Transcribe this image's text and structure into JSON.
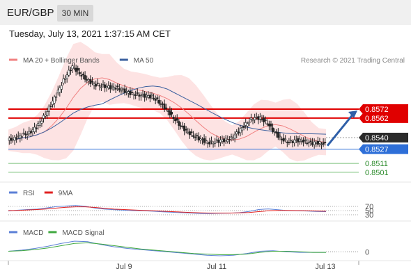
{
  "header": {
    "pair": "EUR/GBP",
    "interval": "30 MIN"
  },
  "timestamp": "Tuesday, July 13, 2021 1:37:15 AM CET",
  "main_panel": {
    "legend": [
      {
        "name": "MA 20 + Bollinger Bands",
        "color": "#f08080"
      },
      {
        "name": "MA 50",
        "color": "#3a5f9e"
      }
    ],
    "credit": "Research © 2021 Trading Central"
  },
  "rsi_panel": {
    "legend": [
      {
        "name": "RSI",
        "color": "#5b7fd6"
      },
      {
        "name": "9MA",
        "color": "#e02020"
      }
    ]
  },
  "macd_panel": {
    "legend": [
      {
        "name": "MACD",
        "color": "#5b7fd6"
      },
      {
        "name": "MACD Signal",
        "color": "#3fa83f"
      }
    ]
  },
  "chart_data": [
    {
      "type": "candlestick",
      "title": "EUR/GBP",
      "x_labels": [
        "Jul 9",
        "Jul 11",
        "Jul 13"
      ],
      "ylim": [
        0.849,
        0.864
      ],
      "price_tags": [
        {
          "label": "0.8572",
          "value": 0.8572,
          "style": "red-box"
        },
        {
          "label": "0.8562",
          "value": 0.8562,
          "style": "red-box"
        },
        {
          "label": "0.8540",
          "value": 0.854,
          "style": "dark-box"
        },
        {
          "label": "0.8527",
          "value": 0.8527,
          "style": "blue-box"
        },
        {
          "label": "0.8511",
          "value": 0.8511,
          "style": "green-text"
        },
        {
          "label": "0.8501",
          "value": 0.8501,
          "style": "green-text"
        }
      ],
      "horizontal_lines": [
        {
          "value": 0.8572,
          "color": "#e00000"
        },
        {
          "value": 0.8562,
          "color": "#e00000"
        },
        {
          "value": 0.8527,
          "color": "#2e6fd8"
        },
        {
          "value": 0.8511,
          "color": "#7ac17a"
        },
        {
          "value": 0.8501,
          "color": "#7ac17a"
        }
      ],
      "close_series": [
        0.8537,
        0.8539,
        0.8543,
        0.8545,
        0.8552,
        0.8563,
        0.8577,
        0.8592,
        0.8608,
        0.862,
        0.8612,
        0.8605,
        0.86,
        0.8598,
        0.8597,
        0.8596,
        0.8593,
        0.859,
        0.8588,
        0.8587,
        0.8586,
        0.858,
        0.8572,
        0.8562,
        0.8553,
        0.8546,
        0.8541,
        0.8537,
        0.8534,
        0.8536,
        0.8537,
        0.8539,
        0.8547,
        0.8555,
        0.8562,
        0.8562,
        0.8556,
        0.8546,
        0.8538,
        0.8535,
        0.8537,
        0.8536,
        0.8534,
        0.8534,
        0.8533
      ],
      "forecast_arrow": {
        "from": 0.8534,
        "to": 0.8572
      }
    },
    {
      "type": "line",
      "title": "RSI",
      "series": [
        {
          "name": "RSI",
          "values": [
            48,
            52,
            55,
            57,
            63,
            69,
            72,
            74,
            71,
            62,
            57,
            54,
            52,
            50,
            49,
            47,
            44,
            42,
            40,
            38,
            36,
            36,
            37,
            38,
            40,
            46,
            55,
            58,
            54,
            50,
            49,
            48,
            46,
            45
          ]
        },
        {
          "name": "9MA",
          "values": [
            50,
            51,
            53,
            55,
            58,
            62,
            66,
            68,
            68,
            65,
            61,
            57,
            55,
            53,
            51,
            49,
            47,
            45,
            43,
            41,
            39,
            38,
            38,
            38,
            39,
            41,
            45,
            49,
            51,
            51,
            50,
            49,
            48,
            47
          ]
        }
      ],
      "levels": [
        70,
        50,
        30
      ],
      "ylim": [
        0,
        100
      ]
    },
    {
      "type": "line",
      "title": "MACD",
      "series": [
        {
          "name": "MACD",
          "values": [
            0.0001,
            0.0003,
            0.0006,
            0.001,
            0.0015,
            0.0019,
            0.0018,
            0.0013,
            0.0009,
            0.0006,
            0.0004,
            0.0002,
            0.0,
            -0.0002,
            -0.0004,
            -0.0006,
            -0.0007,
            -0.0006,
            -0.0003,
            0.0001,
            0.0002,
            0.0,
            -0.0001,
            -0.0001,
            -0.0001
          ]
        },
        {
          "name": "MACD Signal",
          "values": [
            0.0001,
            0.0002,
            0.0004,
            0.0007,
            0.0011,
            0.0015,
            0.0016,
            0.0014,
            0.0011,
            0.0008,
            0.0005,
            0.0003,
            0.0001,
            -0.0001,
            -0.0003,
            -0.0004,
            -0.0005,
            -0.0005,
            -0.0004,
            -0.0001,
            0.0001,
            0.0001,
            0.0,
            -0.0001,
            -0.0001
          ]
        }
      ],
      "levels": [
        0
      ],
      "ylim": [
        -0.0012,
        0.0024
      ]
    }
  ]
}
